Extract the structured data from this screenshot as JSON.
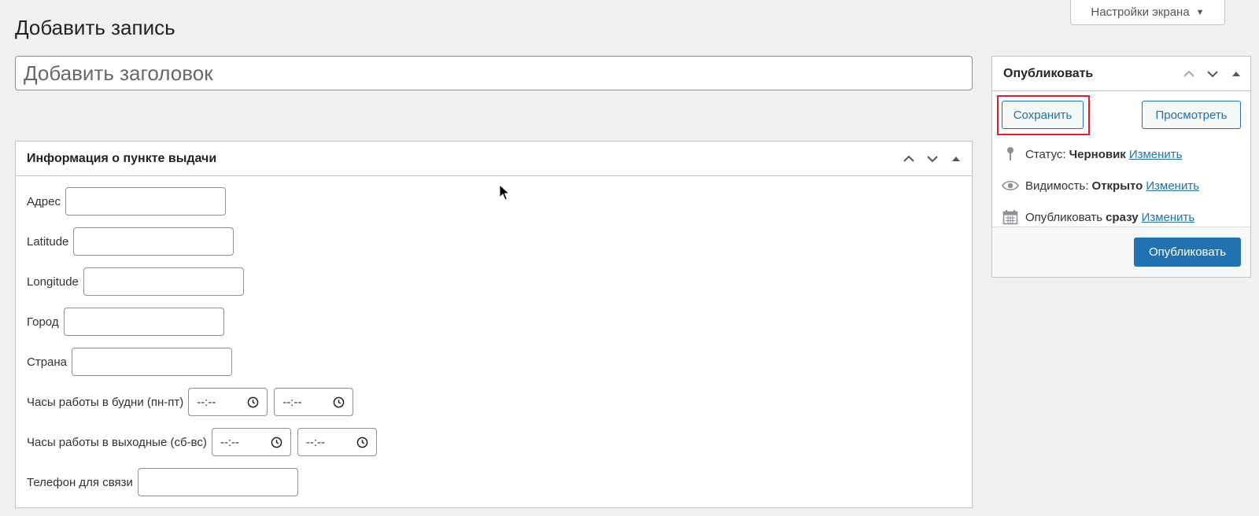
{
  "screen_options": {
    "label": "Настройки экрана"
  },
  "page": {
    "title": "Добавить запись"
  },
  "title_field": {
    "placeholder": "Добавить заголовок",
    "value": ""
  },
  "metabox": {
    "title": "Информация о пункте выдачи",
    "fields": {
      "address": {
        "label": "Адрес"
      },
      "latitude": {
        "label": "Latitude"
      },
      "longitude": {
        "label": "Longitude"
      },
      "city": {
        "label": "Город"
      },
      "country": {
        "label": "Страна"
      },
      "weekday_hours": {
        "label": "Часы работы в будни (пн-пт)",
        "from": "--:--",
        "to": "--:--"
      },
      "weekend_hours": {
        "label": "Часы работы в выходные (сб-вс)",
        "from": "--:--",
        "to": "--:--"
      },
      "phone": {
        "label": "Телефон для связи"
      }
    }
  },
  "publish": {
    "title": "Опубликовать",
    "save_label": "Сохранить",
    "preview_label": "Просмотреть",
    "status": {
      "prefix": "Статус:",
      "value": "Черновик",
      "link": "Изменить"
    },
    "visibility": {
      "prefix": "Видимость:",
      "value": "Открыто",
      "link": "Изменить"
    },
    "schedule": {
      "prefix": "Опубликовать",
      "value": "сразу",
      "link": "Изменить"
    },
    "publish_label": "Опубликовать"
  },
  "colors": {
    "accent": "#2271b1",
    "highlight": "#e11d2a",
    "background": "#f0f0f1"
  }
}
